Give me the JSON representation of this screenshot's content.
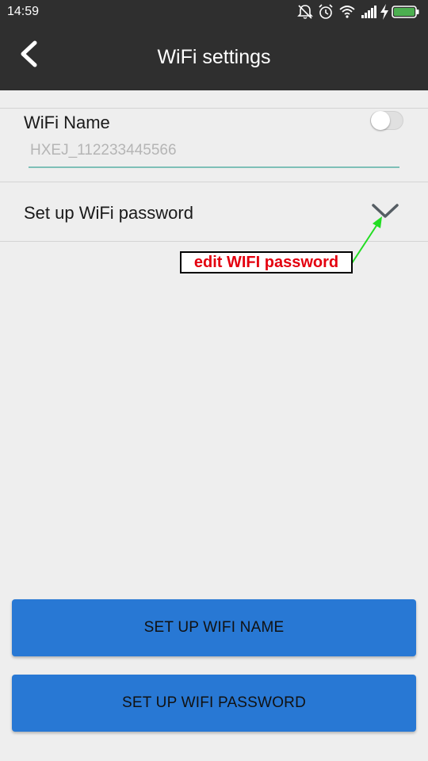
{
  "status_bar": {
    "time": "14:59",
    "icons": [
      "mute-icon",
      "alarm-icon",
      "wifi-signal-icon",
      "cell-signal-icon",
      "charging-icon",
      "battery-icon"
    ],
    "battery_color": "#4caf50"
  },
  "app_bar": {
    "title": "WiFi settings",
    "back_icon": "chevron-left-icon",
    "background": "#2f2f2f"
  },
  "wifi_name": {
    "label": "WiFi Name",
    "placeholder": "HXEJ_112233445566",
    "value": "",
    "toggle_on": false,
    "underline_color": "#7ebfb7"
  },
  "password_row": {
    "label": "Set up WiFi password",
    "icon": "chevron-down-icon"
  },
  "annotation": {
    "text": "edit WIFI password",
    "text_color": "#e4000f",
    "arrow_color": "#22dd22"
  },
  "buttons": {
    "set_name": "SET UP WIFI NAME",
    "set_password": "SET UP WIFI PASSWORD",
    "color": "#2878d4"
  }
}
